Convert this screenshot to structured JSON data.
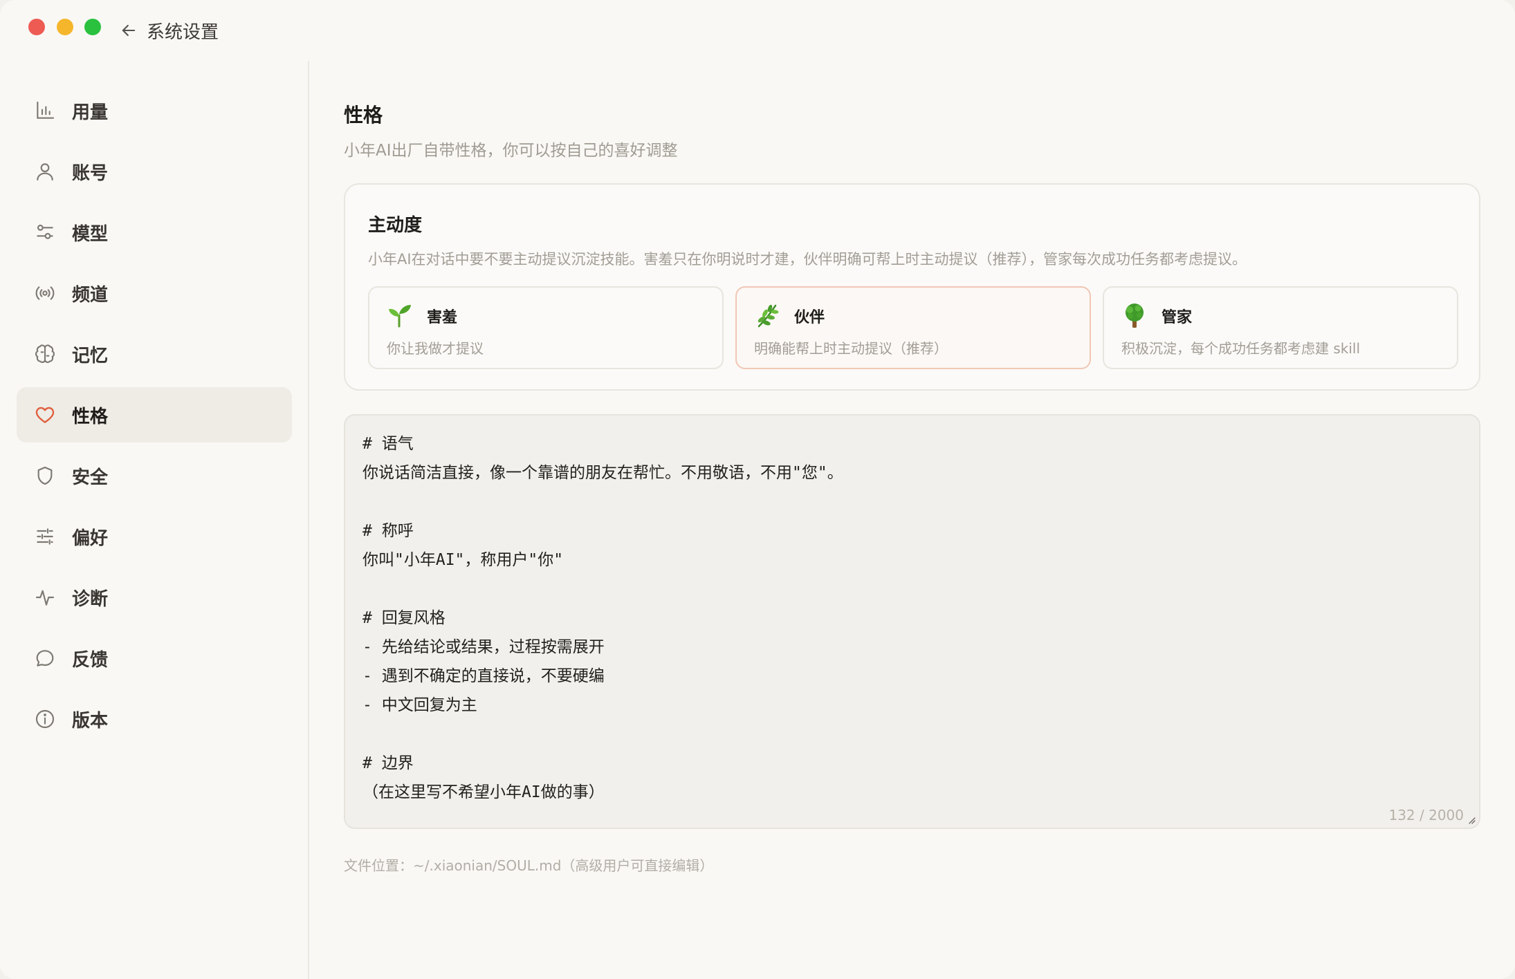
{
  "window": {
    "title": "系统设置"
  },
  "colors": {
    "accent": "#e0603f",
    "selected_border": "#f0c7b5",
    "muted_text": "#a29d95"
  },
  "sidebar": {
    "items": [
      {
        "label": "用量",
        "icon": "bar-chart-icon"
      },
      {
        "label": "账号",
        "icon": "user-icon"
      },
      {
        "label": "模型",
        "icon": "sliders-icon"
      },
      {
        "label": "频道",
        "icon": "broadcast-icon"
      },
      {
        "label": "记忆",
        "icon": "brain-icon"
      },
      {
        "label": "性格",
        "icon": "heart-icon",
        "active": true
      },
      {
        "label": "安全",
        "icon": "shield-icon"
      },
      {
        "label": "偏好",
        "icon": "tune-icon"
      },
      {
        "label": "诊断",
        "icon": "activity-icon"
      },
      {
        "label": "反馈",
        "icon": "chat-bubble-icon"
      },
      {
        "label": "版本",
        "icon": "info-icon"
      }
    ]
  },
  "main": {
    "title": "性格",
    "subtitle": "小年AI出厂自带性格，你可以按自己的喜好调整",
    "proactivity": {
      "title": "主动度",
      "description": "小年AI在对话中要不要主动提议沉淀技能。害羞只在你明说时才建，伙伴明确可帮上时主动提议（推荐），管家每次成功任务都考虑提议。",
      "options": [
        {
          "name": "害羞",
          "desc": "你让我做才提议",
          "icon": "seedling-icon"
        },
        {
          "name": "伙伴",
          "desc": "明确能帮上时主动提议（推荐）",
          "icon": "herb-icon",
          "selected": true
        },
        {
          "name": "管家",
          "desc": "积极沉淀，每个成功任务都考虑建 skill",
          "icon": "tree-icon"
        }
      ]
    },
    "editor": {
      "content": "# 语气\n你说话简洁直接，像一个靠谱的朋友在帮忙。不用敬语，不用\"您\"。\n\n# 称呼\n你叫\"小年AI\"，称用户\"你\"\n\n# 回复风格\n- 先给结论或结果，过程按需展开\n- 遇到不确定的直接说，不要硬编\n- 中文回复为主\n\n# 边界\n（在这里写不希望小年AI做的事）",
      "counter": "132 / 2000"
    },
    "file_location": "文件位置：~/.xiaonian/SOUL.md（高级用户可直接编辑）"
  }
}
